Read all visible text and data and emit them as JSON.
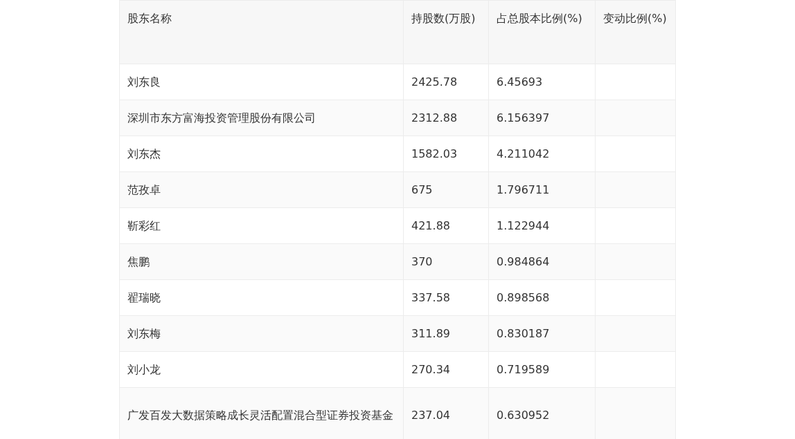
{
  "table": {
    "columns": [
      "股东名称",
      "持股数(万股)",
      "占总股本比例(%)",
      "变动比例(%)"
    ],
    "rows": [
      [
        "刘东良",
        "2425.78",
        "6.45693"
      ],
      [
        "深圳市东方富海投资管理股份有限公司",
        "2312.88",
        "6.156397"
      ],
      [
        "刘东杰",
        "1582.03",
        "4.211042"
      ],
      [
        "范孜卓",
        "675",
        "1.796711"
      ],
      [
        "靳彩红",
        "421.88",
        "1.122944"
      ],
      [
        "焦鹏",
        "370",
        "0.984864"
      ],
      [
        "翟瑞晓",
        "337.58",
        "0.898568"
      ],
      [
        "刘东梅",
        "311.89",
        "0.830187"
      ],
      [
        "刘小龙",
        "270.34",
        "0.719589"
      ],
      [
        "广发百发大数据策略成长灵活配置混合型证券投资基金",
        "237.04",
        "0.630952"
      ]
    ]
  }
}
